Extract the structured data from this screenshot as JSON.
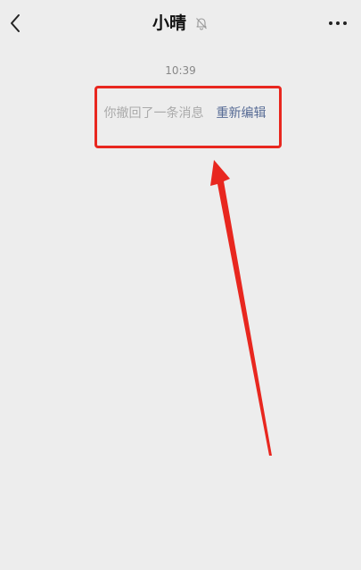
{
  "header": {
    "title": "小晴",
    "back_icon": "chevron-left-icon",
    "mute_icon": "bell-off-icon",
    "more_icon": "more-dots-icon"
  },
  "chat": {
    "timestamp": "10:39",
    "recall_text": "你撤回了一条消息",
    "reedit_label": "重新编辑"
  },
  "colors": {
    "background": "#ededed",
    "link": "#576b95",
    "annotation": "#e8271f"
  }
}
